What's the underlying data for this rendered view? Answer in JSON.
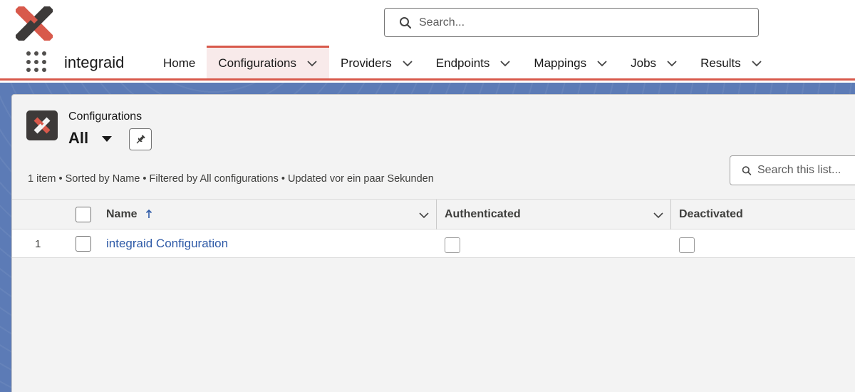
{
  "header": {
    "search_placeholder": "Search..."
  },
  "nav": {
    "app_name": "integraid",
    "items": [
      {
        "label": "Home",
        "has_menu": false,
        "active": false
      },
      {
        "label": "Configurations",
        "has_menu": true,
        "active": true
      },
      {
        "label": "Providers",
        "has_menu": true,
        "active": false
      },
      {
        "label": "Endpoints",
        "has_menu": true,
        "active": false
      },
      {
        "label": "Mappings",
        "has_menu": true,
        "active": false
      },
      {
        "label": "Jobs",
        "has_menu": true,
        "active": false
      },
      {
        "label": "Results",
        "has_menu": true,
        "active": false
      }
    ]
  },
  "list_view": {
    "object_label": "Configurations",
    "view_name": "All",
    "meta": "1 item • Sorted by Name • Filtered by All configurations • Updated vor ein paar Sekunden",
    "search_placeholder": "Search this list...",
    "columns": [
      {
        "label": "Name",
        "sorted": "ascending"
      },
      {
        "label": "Authenticated"
      },
      {
        "label": "Deactivated"
      }
    ],
    "rows": [
      {
        "num": "1",
        "name": "integraid Configuration",
        "authenticated": false,
        "deactivated": false
      }
    ]
  },
  "colors": {
    "accent": "#d8594b",
    "link": "#2e5aa7",
    "logo_dark": "#3d3a39",
    "logo_red": "#d8594b"
  },
  "icons": [
    "integraid-logo-icon",
    "search-icon",
    "app-launcher-icon",
    "chevron-down-icon",
    "caret-down-icon",
    "pin-icon",
    "sort-arrow-up-icon"
  ]
}
